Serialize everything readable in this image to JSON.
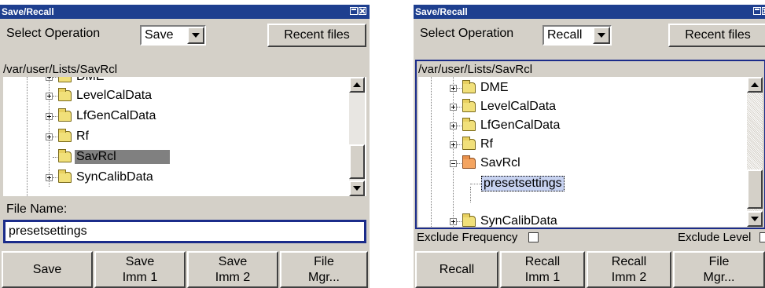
{
  "left": {
    "title": "Save/Recall",
    "select_operation_label": "Select Operation",
    "operation_value": "Save",
    "recent_files": "Recent files",
    "path": "/var/user/Lists/SavRcl",
    "tree_items": [
      "DME",
      "LevelCalData",
      "LfGenCalData",
      "Rf",
      "SavRcl",
      "SynCalibData"
    ],
    "file_name_label": "File Name:",
    "file_name_value": "presetsettings",
    "buttons": [
      {
        "l1": "Save",
        "l2": ""
      },
      {
        "l1": "Save",
        "l2": "Imm 1"
      },
      {
        "l1": "Save",
        "l2": "Imm 2"
      },
      {
        "l1": "File",
        "l2": "Mgr..."
      }
    ]
  },
  "right": {
    "title": "Save/Recall",
    "select_operation_label": "Select Operation",
    "operation_value": "Recall",
    "recent_files": "Recent files",
    "path": "/var/user/Lists/SavRcl",
    "tree_items": [
      "DME",
      "LevelCalData",
      "LfGenCalData",
      "Rf",
      "SavRcl",
      "presetsettings",
      "SynCalibData"
    ],
    "exclude_frequency": "Exclude Frequency",
    "exclude_level": "Exclude Level",
    "buttons": [
      {
        "l1": "Recall",
        "l2": ""
      },
      {
        "l1": "Recall",
        "l2": "Imm 1"
      },
      {
        "l1": "Recall",
        "l2": "Imm 2"
      },
      {
        "l1": "File",
        "l2": "Mgr..."
      }
    ]
  }
}
